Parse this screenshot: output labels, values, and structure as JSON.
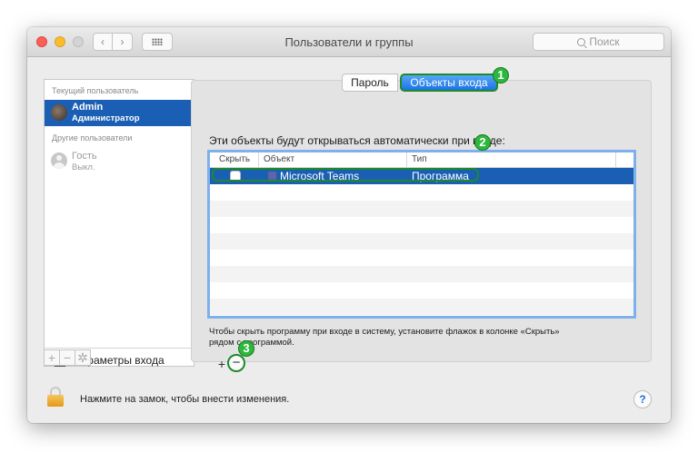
{
  "window": {
    "title": "Пользователи и группы"
  },
  "toolbar": {
    "search_placeholder": "Поиск"
  },
  "sidebar": {
    "current_user_header": "Текущий пользователь",
    "current_user": {
      "name": "Admin",
      "role": "Администратор"
    },
    "other_users_header": "Другие пользователи",
    "other_users": [
      {
        "name": "Гость",
        "status": "Выкл."
      }
    ],
    "login_options_label": "Параметры входа",
    "tools": {
      "add": "+",
      "remove": "−"
    }
  },
  "tabs": [
    {
      "label": "Пароль",
      "selected": false
    },
    {
      "label": "Объекты входа",
      "selected": true
    }
  ],
  "login_items": {
    "description": "Эти объекты будут открываться автоматически при входе:",
    "columns": [
      "Скрыть",
      "Объект",
      "Тип"
    ],
    "rows": [
      {
        "hide": false,
        "item": "Microsoft Teams",
        "type": "Программа",
        "selected": true
      }
    ],
    "hint": "Чтобы скрыть программу при входе в систему, установите флажок в колонке «Скрыть» рядом с программой.",
    "add_label": "+",
    "remove_label": "−"
  },
  "annotations": [
    "1",
    "2",
    "3"
  ],
  "footer": {
    "lock_text": "Нажмите на замок, чтобы внести изменения.",
    "help_label": "?"
  },
  "colors": {
    "selection": "#1a5fb4",
    "highlight_outline": "#1e8a2a",
    "badge": "#2db83d"
  }
}
